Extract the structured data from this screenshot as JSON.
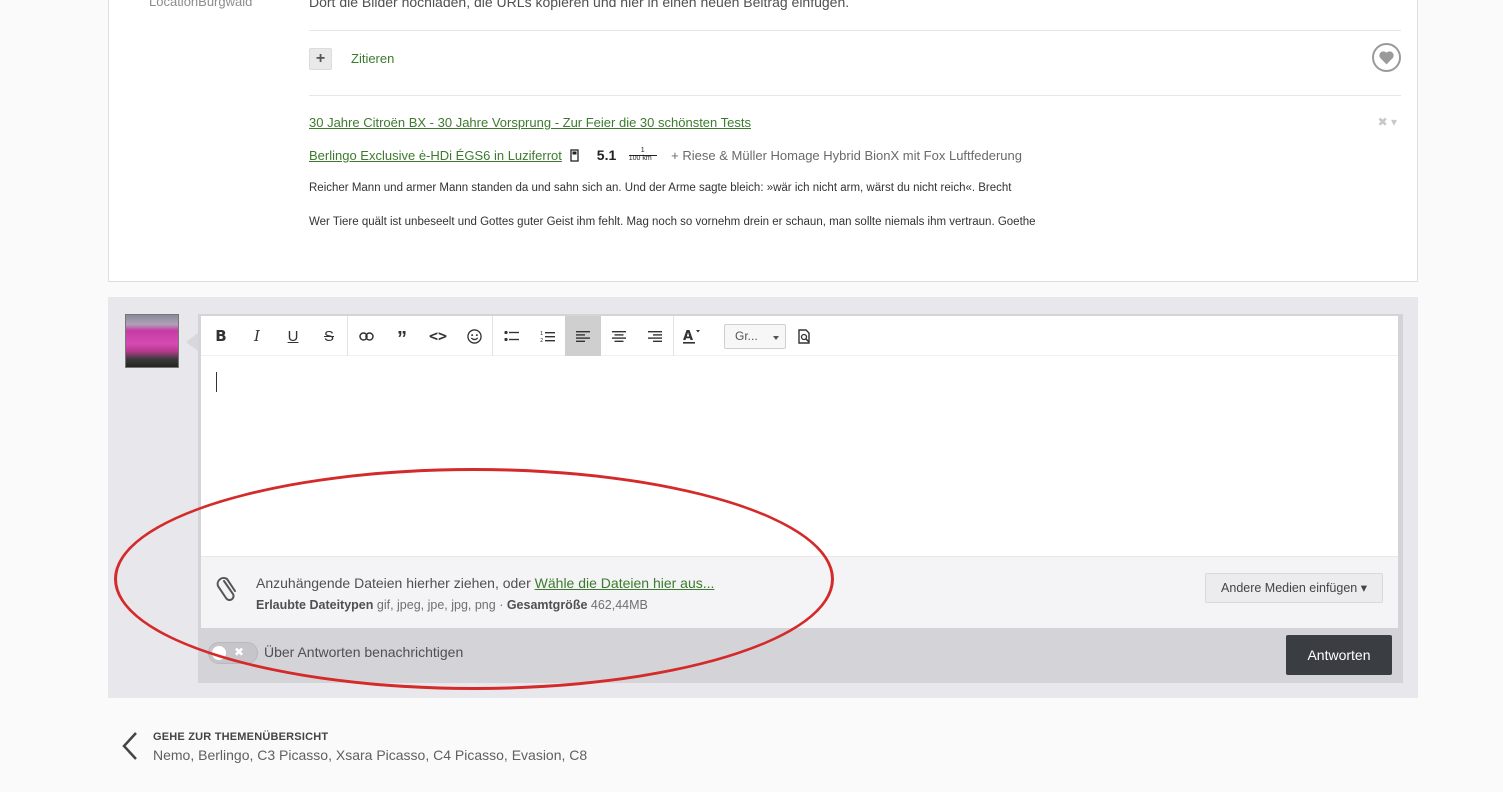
{
  "post": {
    "location_label": "LocationBurgwald",
    "text_top": "Dort die Bilder hochladen, die URLs kopieren und hier in einen neuen Beitrag einfügen.",
    "quote_label": "Zitieren",
    "signature": {
      "link1": "30 Jahre Citroën BX - 30 Jahre Vorsprung - Zur Feier die 30 schönsten Tests",
      "link2": "Berlingo Exclusive ė-HDi ÉGS6 in Luziferrot",
      "consumption": "5.1",
      "consumption_unit": "100 km",
      "bike": "+ Riese & Müller Homage Hybrid BionX mit Fox Luftfederung",
      "quote1": "Reicher Mann und armer Mann standen da und sahn sich an. Und der Arme sagte bleich: »wär ich nicht arm, wärst du nicht reich«. Brecht",
      "quote2": "Wer Tiere quält ist unbeseelt und Gottes guter Geist ihm fehlt. Mag noch so vornehm drein er schaun, man sollte niemals ihm vertraun. Goethe"
    }
  },
  "editor": {
    "font_select": "Gr...",
    "attach": {
      "text": "Anzuhängende Dateien hierher ziehen, oder ",
      "link": "Wähle die Dateien hier aus...",
      "types_label": "Erlaubte Dateitypen",
      "types": "gif, jpeg, jpe, jpg, png",
      "separator": " · ",
      "size_label": "Gesamtgröße",
      "size": "462,44MB",
      "media_button": "Andere Medien einfügen ▾"
    },
    "notify_label": "Über Antworten benachrichtigen",
    "reply_button": "Antworten"
  },
  "nav": {
    "back_title": "GEHE ZUR THEMENÜBERSICHT",
    "back_sub": "Nemo, Berlingo, C3 Picasso, Xsara Picasso, C4 Picasso, Evasion, C8"
  },
  "colors": {
    "link": "#3c7a2e",
    "annotation": "#d42a2a",
    "reply_button": "#3a3d42"
  }
}
